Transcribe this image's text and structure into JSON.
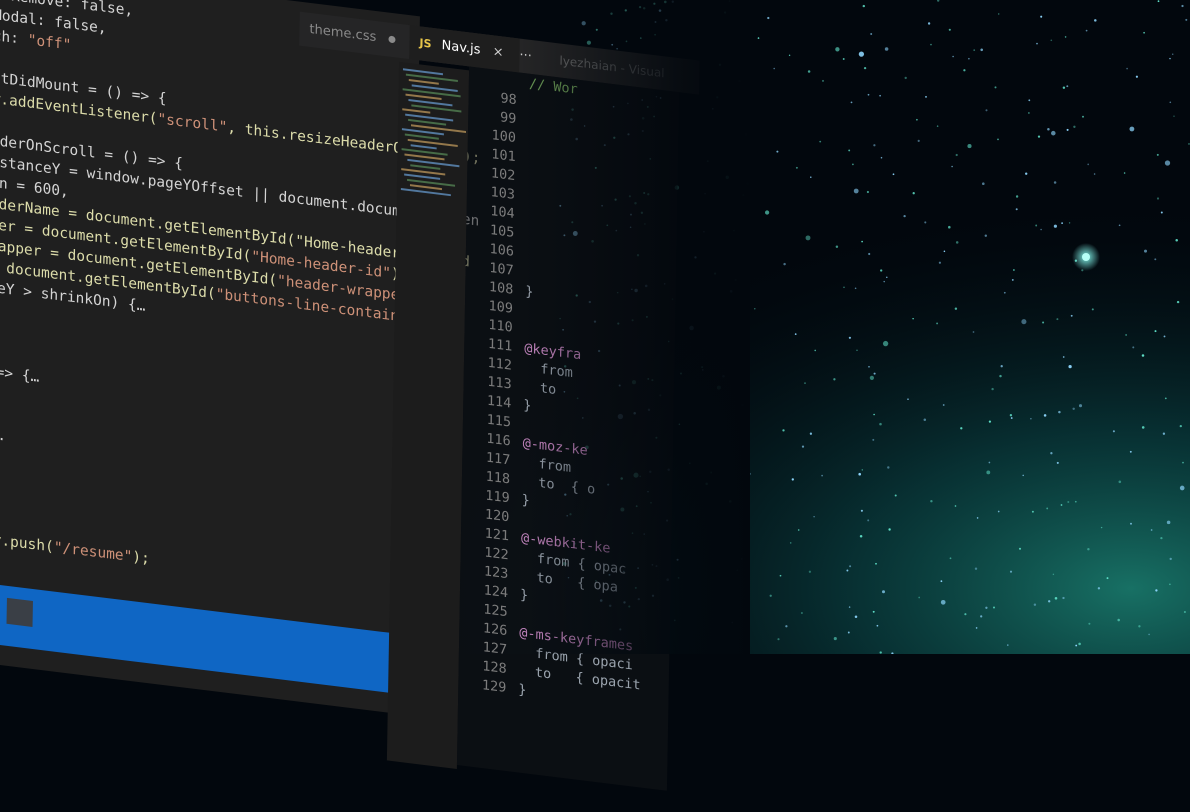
{
  "window": {
    "title_partial": "lyezhaian - Visual",
    "tabs": [
      {
        "label": "theme.css",
        "active": false,
        "modified": true
      },
      {
        "label": "Nav.js",
        "active": true,
        "icon": "JS",
        "close": "×"
      }
    ],
    "more_label": "···"
  },
  "code": {
    "lines": [
      "erRemove: false,",
      "Modal: false,",
      "ch: \"off\"",
      "",
      "ntDidMount = () => {",
      "w.addEventListener(\"scroll\", this.resizeHeaderOnScroll);",
      "",
      "aderOnScroll = () => {",
      "istanceY = window.pageYOffset || document.documentElemen",
      "On = 600,",
      "aderName = document.getElementById(\"Home-header-name-id",
      "der = document.getElementById(\"Home-header-id\"),",
      "rapper = document.getElementById(\"header-wrapper-id\"),",
      "= document.getElementById(\"buttons-line-container-id\"",
      "ceY > shrinkOn) {…",
      "",
      "",
      "",
      " => {…",
      "",
      "",
      "{…",
      "",
      "",
      "",
      "",
      "ry.push(\"/resume\");"
    ]
  },
  "side": {
    "top_comment": "// Wor",
    "line_numbers": [
      "98",
      "99",
      "100",
      "101",
      "102",
      "103",
      "104",
      "105",
      "106",
      "107",
      "108",
      "109",
      "110",
      "111",
      "112",
      "113",
      "114",
      "115",
      "116",
      "117",
      "118",
      "119",
      "120",
      "121",
      "122",
      "123",
      "124",
      "125",
      "126",
      "127",
      "128",
      "129"
    ],
    "lines": [
      "",
      "",
      "",
      "",
      "",
      "",
      "",
      "",
      "",
      "",
      "}",
      "",
      "",
      "@keyfra",
      "  from",
      "  to",
      "}",
      "",
      "@-moz-ke",
      "  from",
      "  to  { o",
      "}",
      "",
      "@-webkit-ke",
      "  from { opac",
      "  to   { opa",
      "}",
      "",
      "@-ms-keyframes",
      "  from { opaci",
      "  to   { opacit",
      "}"
    ]
  },
  "taskbar_color": "#0f66c4",
  "accent": "#0f66c4"
}
